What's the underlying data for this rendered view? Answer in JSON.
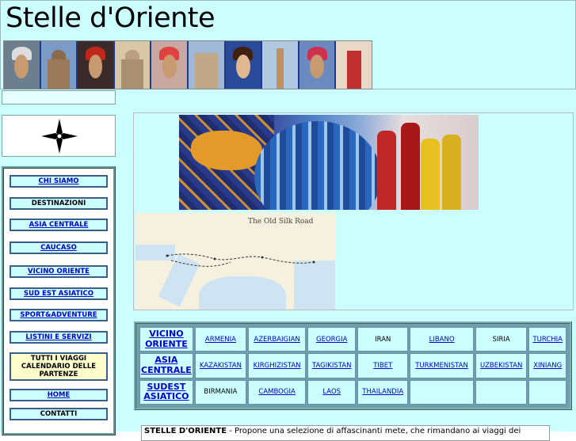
{
  "site": {
    "title": "Stelle d'Oriente"
  },
  "nav": {
    "items": [
      {
        "label": "CHI SIAMO",
        "link": true
      },
      {
        "label": "DESTINAZIONI",
        "link": false
      },
      {
        "label": "ASIA CENTRALE",
        "link": true
      },
      {
        "label": "CAUCASO",
        "link": true
      },
      {
        "label": "VICINO ORIENTE",
        "link": true
      },
      {
        "label": "SUD EST ASIATICO",
        "link": true
      },
      {
        "label": "SPORT&ADVENTURE",
        "link": true
      },
      {
        "label": "LISTINI E SERVIZI",
        "link": true
      },
      {
        "label": "TUTTI I VIAGGI CALENDARIO DELLE PARTENZE",
        "link": false
      },
      {
        "label": "HOME",
        "link": true
      },
      {
        "label": "CONTATTI",
        "link": false
      }
    ]
  },
  "map": {
    "title": "The Old Silk Road"
  },
  "regions": [
    {
      "header": "VICINO ORIENTE",
      "cells": [
        {
          "label": "ARMENIA",
          "link": true
        },
        {
          "label": "AZERBAIGIAN",
          "link": true
        },
        {
          "label": "GEORGIA",
          "link": true
        },
        {
          "label": "IRAN",
          "link": false
        },
        {
          "label": "LIBANO",
          "link": true
        },
        {
          "label": "SIRIA",
          "link": false
        },
        {
          "label": "TURCHIA",
          "link": true
        }
      ]
    },
    {
      "header": "ASIA CENTRALE",
      "cells": [
        {
          "label": "KAZAKISTAN",
          "link": true
        },
        {
          "label": "KIRGHIZISTAN",
          "link": true
        },
        {
          "label": "TAGIKISTAN",
          "link": true
        },
        {
          "label": "TIBET",
          "link": true
        },
        {
          "label": "TURKMENISTAN",
          "link": true
        },
        {
          "label": "UZBEKISTAN",
          "link": true
        },
        {
          "label": "XINIANG",
          "link": true
        }
      ]
    },
    {
      "header": "SUDEST ASIATICO",
      "cells": [
        {
          "label": "BIRMANIA",
          "link": false
        },
        {
          "label": "CAMBOGIA",
          "link": true
        },
        {
          "label": "LAOS",
          "link": true
        },
        {
          "label": "THAILANDIA",
          "link": true
        },
        {
          "label": "",
          "link": false
        },
        {
          "label": "",
          "link": false
        },
        {
          "label": "",
          "link": false
        }
      ]
    }
  ],
  "footer": {
    "bold": "STELLE D'ORIENTE",
    "text": " - Propone  una selezione di affascinanti mete, che rimandano  ai viaggi dei"
  },
  "colors": {
    "background": "#ccffff",
    "link": "#0000cc",
    "panel_border": "#3a5f8a"
  }
}
